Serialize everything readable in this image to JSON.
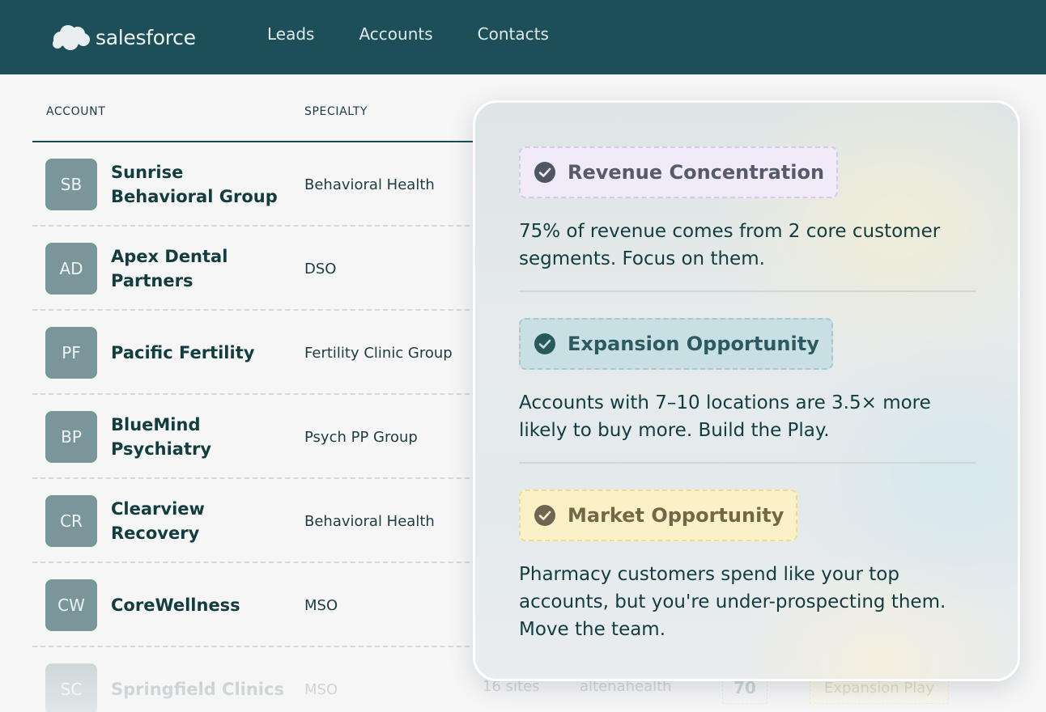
{
  "brand": {
    "name": "salesforce"
  },
  "nav": {
    "items": [
      "Leads",
      "Accounts",
      "Contacts"
    ]
  },
  "table": {
    "headers": {
      "account": "ACCOUNT",
      "specialty": "SPECIALTY"
    },
    "rows": [
      {
        "initials": "SB",
        "name": "Sunrise Behavioral Group",
        "specialty": "Behavioral Health"
      },
      {
        "initials": "AD",
        "name": "Apex Dental Partners",
        "specialty": "DSO"
      },
      {
        "initials": "PF",
        "name": "Pacific Fertility",
        "specialty": "Fertility Clinic Group"
      },
      {
        "initials": "BP",
        "name": "BlueMind Psychiatry",
        "specialty": "Psych PP Group"
      },
      {
        "initials": "CR",
        "name": "Clearview Recovery",
        "specialty": "Behavioral Health"
      },
      {
        "initials": "CW",
        "name": "CoreWellness",
        "specialty": "MSO"
      },
      {
        "initials": "SC",
        "name": "Springfield Clinics",
        "specialty": "MSO",
        "sites": "16 sites",
        "owner": "altenahealth",
        "score": "70",
        "play": "Expansion Play"
      }
    ]
  },
  "insights": [
    {
      "tag": "Revenue Concentration",
      "text": "75% of revenue comes from 2 core customer segments. Focus on them."
    },
    {
      "tag": "Expansion Opportunity",
      "text": "Accounts with 7–10 locations are 3.5× more likely to buy more. Build the Play."
    },
    {
      "tag": "Market Opportunity",
      "text": "Pharmacy customers spend like your top accounts, but you're under-prospecting them. Move the team."
    }
  ],
  "colors": {
    "nav_bg": "#1c4f58",
    "avatar": "#7a969a",
    "tag_purple": "#f1eaf8",
    "tag_teal": "#c8e0e4",
    "tag_yellow": "#fbf1c6"
  },
  "icons": {
    "brand": "cloud-logo-icon",
    "tag": "check-circle-icon"
  }
}
